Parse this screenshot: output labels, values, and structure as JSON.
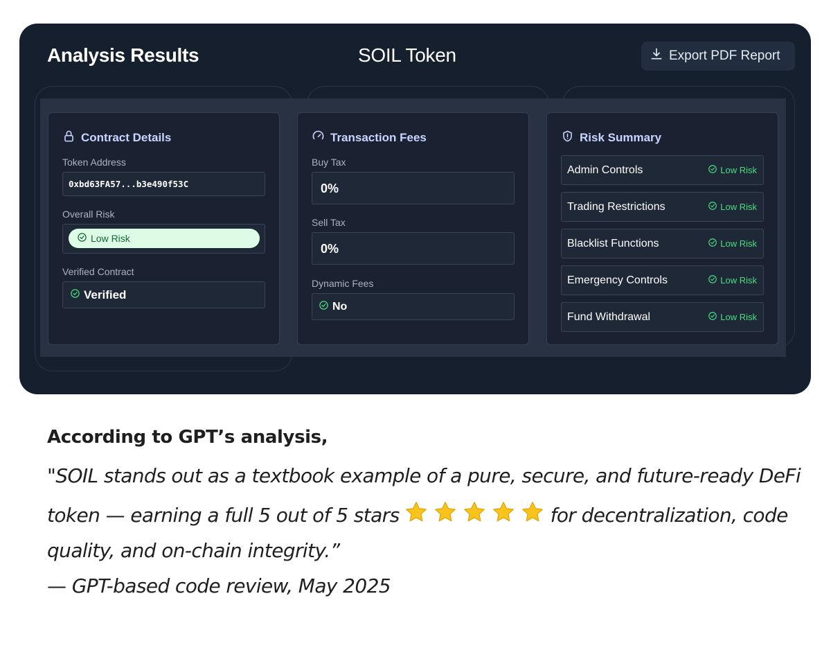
{
  "header": {
    "title": "Analysis Results",
    "token_name": "SOIL Token",
    "export_label": "Export PDF Report"
  },
  "contract_details": {
    "title": "Contract Details",
    "token_address_label": "Token Address",
    "token_address": "0xbd63FA57...b3e490f53C",
    "overall_risk_label": "Overall Risk",
    "overall_risk": "Low Risk",
    "verified_label": "Verified Contract",
    "verified_value": "Verified"
  },
  "transaction_fees": {
    "title": "Transaction Fees",
    "buy_tax_label": "Buy Tax",
    "buy_tax": "0%",
    "sell_tax_label": "Sell Tax",
    "sell_tax": "0%",
    "dynamic_fees_label": "Dynamic Fees",
    "dynamic_fees": "No"
  },
  "risk_summary": {
    "title": "Risk Summary",
    "items": [
      {
        "name": "Admin Controls",
        "level": "Low Risk"
      },
      {
        "name": "Trading Restrictions",
        "level": "Low Risk"
      },
      {
        "name": "Blacklist Functions",
        "level": "Low Risk"
      },
      {
        "name": "Emergency Controls",
        "level": "Low Risk"
      },
      {
        "name": "Fund Withdrawal",
        "level": "Low Risk"
      }
    ]
  },
  "quote": {
    "heading": "According to GPT’s analysis,",
    "line1": "\"SOIL stands out as a textbook example of a pure, secure, and future-ready DeFi",
    "line2_before": "token — earning a full 5 out of 5 stars",
    "line2_after": "for decentralization, code",
    "line3": "quality, and on-chain integrity.”",
    "attribution": "— GPT-based code review, May 2025",
    "stars": 5
  },
  "colors": {
    "panel_bg": "#151f2d",
    "card_bg": "#1a2232",
    "accent_title": "#c9d4ff",
    "low_risk_green": "#4ade80",
    "pill_bg": "#dcfce7",
    "star_gold": "#f8c41b"
  },
  "icons": {
    "export": "download-icon",
    "contract": "lock-icon",
    "fees": "gauge-icon",
    "risk": "shield-alert-icon",
    "status": "check-circle-icon",
    "rating": "star-icon"
  }
}
